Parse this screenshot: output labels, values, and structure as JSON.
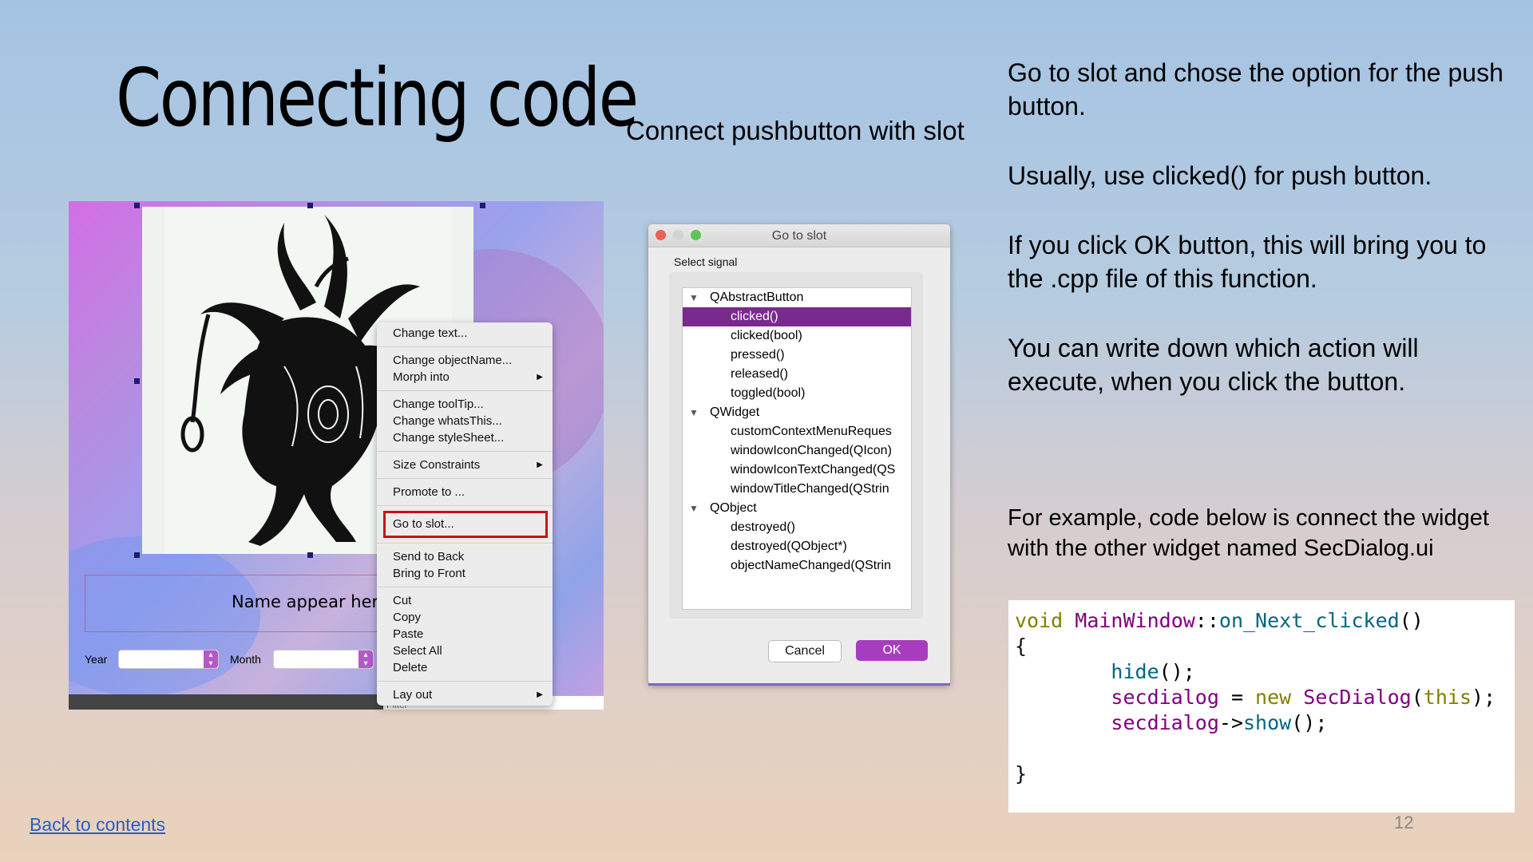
{
  "slide": {
    "title": "Connecting code",
    "subtitle": "Connect pushbutton with slot",
    "bullets": [
      "Go to slot and chose the option for the push button.",
      "Usually, use clicked() for push button.",
      "If you click OK button, this will bring you to the .cpp file of this function.",
      "You can write down which action will execute, when you click the button."
    ],
    "example_text": "For example, code below is connect the widget with the other widget named SecDialog.ui",
    "back_link": "Back to contents",
    "page_number": "12"
  },
  "code": {
    "line1_kw": "void",
    "line1_cls": "MainWindow",
    "line1_sep": "::",
    "line1_fn": "on_Next_clicked",
    "line1_paren": "()",
    "line2": "{",
    "line3_indent": "        ",
    "line3_fn": "hide",
    "line3_end": "();",
    "line4_indent": "        ",
    "line4_var": "secdialog",
    "line4_eq": " = ",
    "line4_kw": "new",
    "line4_cls": "SecDialog",
    "line4_open": "(",
    "line4_this": "this",
    "line4_close": ");",
    "line5_indent": "        ",
    "line5_var": "secdialog",
    "line5_arrow": "->",
    "line5_fn": "show",
    "line5_end": "();",
    "line6": "",
    "line7": "}"
  },
  "designer": {
    "name_label": "Name appear here",
    "year_label": "Year",
    "month_label": "Month",
    "filter_placeholder": "Filter",
    "context_menu": {
      "change_text": "Change text...",
      "change_object_name": "Change objectName...",
      "morph_into": "Morph into",
      "change_tooltip": "Change toolTip...",
      "change_whats_this": "Change whatsThis...",
      "change_stylesheet": "Change styleSheet...",
      "size_constraints": "Size Constraints",
      "promote_to": "Promote to ...",
      "go_to_slot": "Go to slot...",
      "send_to_back": "Send to Back",
      "bring_to_front": "Bring to Front",
      "cut": "Cut",
      "copy": "Copy",
      "paste": "Paste",
      "select_all": "Select All",
      "delete": "Delete",
      "lay_out": "Lay out"
    }
  },
  "dialog": {
    "title": "Go to slot",
    "select_signal_label": "Select signal",
    "groups": {
      "qabstractbutton": "QAbstractButton",
      "qwidget": "QWidget",
      "qobject": "QObject"
    },
    "signals": {
      "clicked": "clicked()",
      "clicked_bool": "clicked(bool)",
      "pressed": "pressed()",
      "released": "released()",
      "toggled_bool": "toggled(bool)",
      "custom_context_menu": "customContextMenuReques",
      "window_icon_changed": "windowIconChanged(QIcon)",
      "window_icon_text_changed": "windowIconTextChanged(QS",
      "window_title_changed": "windowTitleChanged(QStrin",
      "destroyed": "destroyed()",
      "destroyed_qobject": "destroyed(QObject*)",
      "object_name_changed": "objectNameChanged(QStrin"
    },
    "cancel_label": "Cancel",
    "ok_label": "OK",
    "selected_signal": "clicked()"
  },
  "colors": {
    "selection": "#7a2a8e",
    "ok_button": "#a73dbe",
    "highlight_border": "#d10d14",
    "link": "#2a5ec2"
  },
  "icons": {
    "submenu_arrow": "triangle-right",
    "tree_expand": "triangle-down",
    "combo_spinner": "up-down-arrows"
  }
}
